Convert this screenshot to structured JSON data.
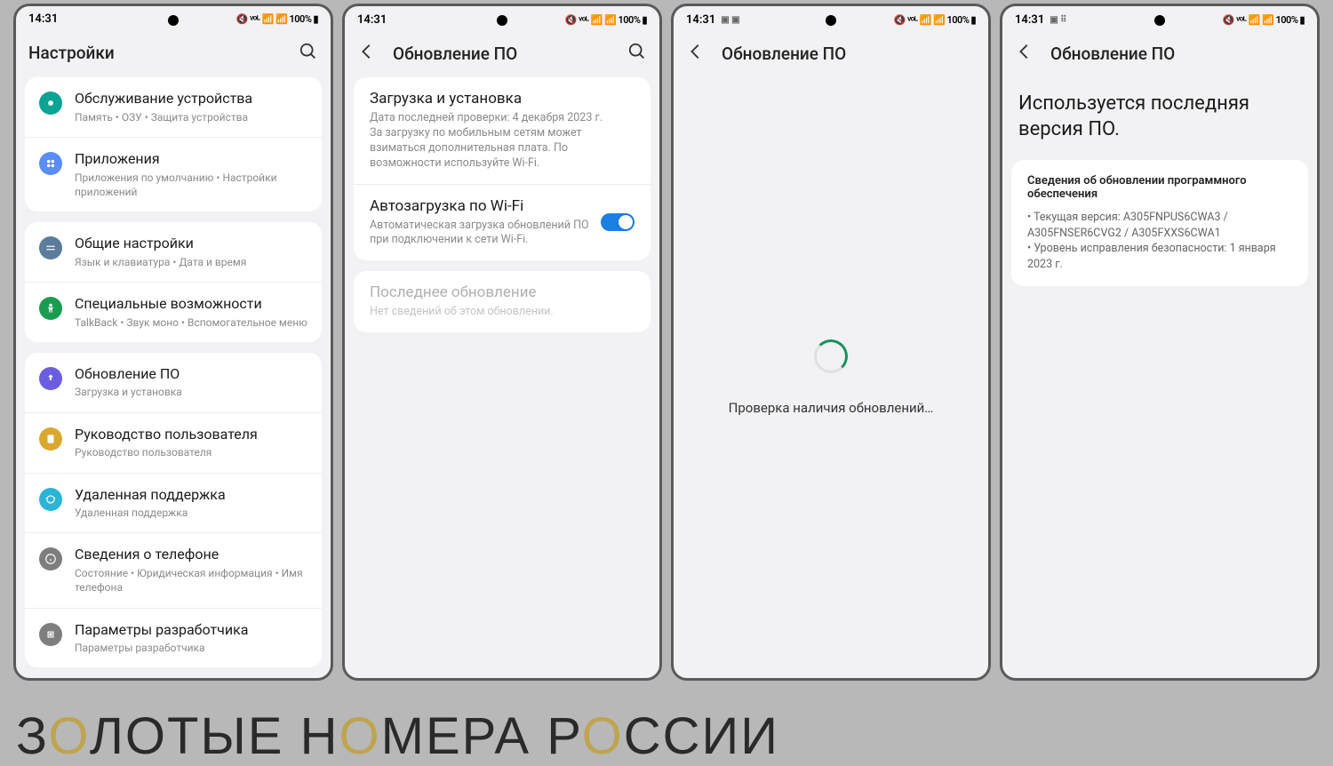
{
  "status": {
    "time": "14:31",
    "battery": "100%",
    "indicators": "📶 📶"
  },
  "screen1": {
    "title": "Настройки",
    "groups": [
      [
        {
          "icon": "device-care",
          "color": "#0ba394",
          "title": "Обслуживание устройства",
          "sub": "Память  •  ОЗУ  •  Защита устройства"
        },
        {
          "icon": "apps",
          "color": "#5a8df7",
          "title": "Приложения",
          "sub": "Приложения по умолчанию  •  Настройки приложений"
        }
      ],
      [
        {
          "icon": "general",
          "color": "#5c7c9c",
          "title": "Общие настройки",
          "sub": "Язык и клавиатура  •  Дата и время"
        },
        {
          "icon": "accessibility",
          "color": "#1a9c4f",
          "title": "Специальные возможности",
          "sub": "TalkBack  •  Звук моно  •  Вспомогательное меню"
        }
      ],
      [
        {
          "icon": "update",
          "color": "#6b5de0",
          "title": "Обновление ПО",
          "sub": "Загрузка и установка"
        },
        {
          "icon": "manual",
          "color": "#d9a82f",
          "title": "Руководство пользователя",
          "sub": "Руководство пользователя"
        },
        {
          "icon": "support",
          "color": "#2ab5d6",
          "title": "Удаленная поддержка",
          "sub": "Удаленная поддержка"
        },
        {
          "icon": "about",
          "color": "#7e7e7e",
          "title": "Сведения о телефоне",
          "sub": "Состояние  •  Юридическая информация  •  Имя телефона"
        },
        {
          "icon": "dev",
          "color": "#7e7e7e",
          "title": "Параметры разработчика",
          "sub": "Параметры разработчика"
        }
      ]
    ]
  },
  "screen2": {
    "title": "Обновление ПО",
    "items": [
      {
        "title": "Загрузка и установка",
        "sub": "Дата последней проверки: 4 декабря 2023 г.\nЗа загрузку по мобильным сетям может взиматься дополнительная плата. По возможности используйте Wi-Fi."
      },
      {
        "title": "Автозагрузка по Wi-Fi",
        "sub": "Автоматическая загрузка обновлений ПО при подключении к сети Wi-Fi.",
        "toggle": true
      }
    ],
    "item_muted": {
      "title": "Последнее обновление",
      "sub": "Нет сведений об этом обновлении."
    }
  },
  "screen3": {
    "title": "Обновление ПО",
    "loading": "Проверка наличия обновлений…"
  },
  "screen4": {
    "title": "Обновление ПО",
    "headline": "Используется последняя версия ПО.",
    "info_title": "Сведения об обновлении программного обеспечения",
    "line1": "• Текущая версия: A305FNPUS6CWA3 / A305FNSER6CVG2 / A305FXXS6CWA1",
    "line2": "• Уровень исправления безопасности: 1 января 2023 г."
  },
  "watermark": {
    "p1": "З",
    "p2": "О",
    "p3": "ЛОТЫЕ  Н",
    "p4": "О",
    "p5": "МЕРА  Р",
    "p6": "О",
    "p7": "ССИИ"
  }
}
